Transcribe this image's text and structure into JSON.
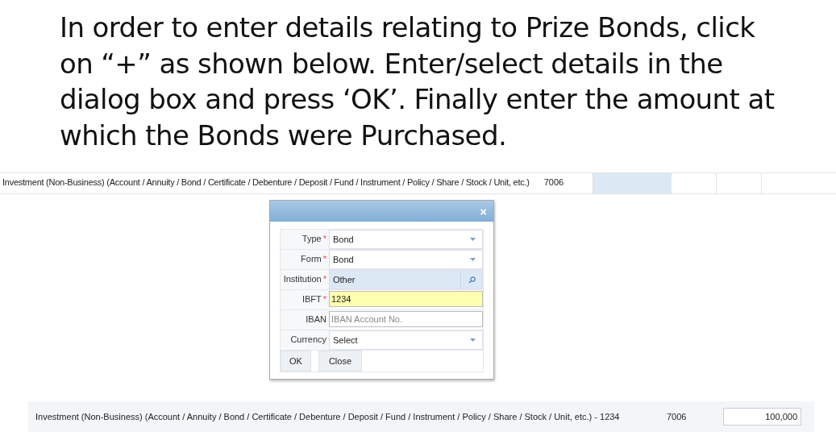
{
  "instruction": "In order to enter details relating to Prize Bonds, click on “+” as shown below. Enter/select details in the dialog box and press ‘OK’. Finally enter the amount at which the Bonds were Purchased.",
  "top_row": {
    "description": "Investment (Non-Business) (Account / Annuity / Bond / Certificate / Debenture / Deposit / Fund / Instrument / Policy / Share / Stock / Unit, etc.)",
    "code": "7006"
  },
  "dialog": {
    "close": "×",
    "fields": [
      {
        "label": "Type",
        "required_mark": "*",
        "kind": "select",
        "value": "Bond"
      },
      {
        "label": "Form",
        "required_mark": "*",
        "kind": "select",
        "value": "Bond"
      },
      {
        "label": "Institution",
        "required_mark": "*",
        "kind": "lookup",
        "value": "Other"
      },
      {
        "label": "IBFT",
        "required_mark": "*",
        "kind": "text",
        "value": "1234",
        "focused": true
      },
      {
        "label": "IBAN",
        "kind": "text",
        "placeholder": "IBAN Account No.",
        "focused": false
      },
      {
        "label": "Currency",
        "kind": "select",
        "value": "Select"
      }
    ],
    "buttons": [
      "OK",
      "Close"
    ]
  },
  "bottom_row": {
    "description": "Investment (Non-Business) (Account / Annuity / Bond / Certificate / Debenture / Deposit / Fund / Instrument / Policy / Share / Stock / Unit, etc.) - 1234",
    "code": "7006",
    "amount": "100,000"
  }
}
